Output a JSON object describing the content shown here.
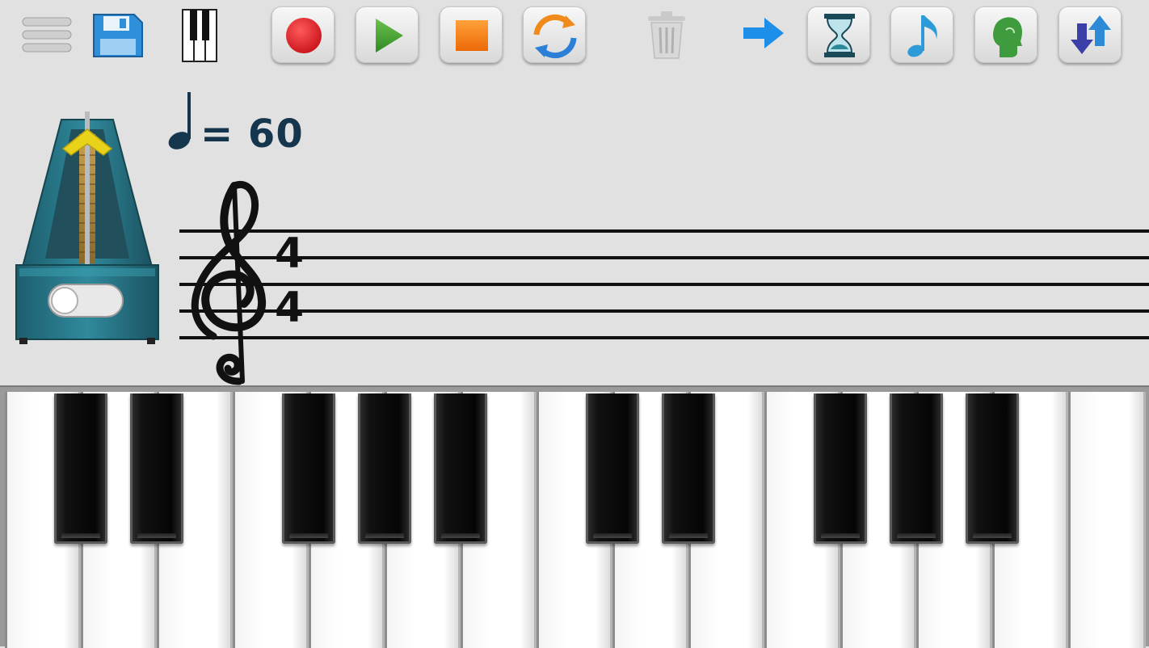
{
  "toolbar": {
    "buttons": [
      {
        "id": "menu",
        "icon": "menu-icon"
      },
      {
        "id": "save",
        "icon": "floppy-disk-icon"
      },
      {
        "id": "keyboard",
        "icon": "piano-keys-icon"
      },
      {
        "id": "record",
        "icon": "record-icon",
        "color": "#e01e25"
      },
      {
        "id": "play",
        "icon": "play-icon",
        "color": "#3a9a2a"
      },
      {
        "id": "stop",
        "icon": "stop-icon",
        "color": "#f07d10"
      },
      {
        "id": "loop",
        "icon": "loop-icon",
        "color": "#2b7fd6"
      },
      {
        "id": "delete",
        "icon": "trash-icon"
      },
      {
        "id": "next",
        "icon": "arrow-right-icon",
        "color": "#1e8fe8"
      },
      {
        "id": "tempo",
        "icon": "hourglass-icon"
      },
      {
        "id": "note",
        "icon": "music-note-icon"
      },
      {
        "id": "voice",
        "icon": "listen-head-icon"
      },
      {
        "id": "transpose",
        "icon": "up-down-arrows-icon"
      }
    ]
  },
  "tempo": {
    "note_icon": "quarter-note-icon",
    "text": "= 60"
  },
  "staff": {
    "clef": "treble-clef-icon",
    "time_signature": {
      "numerator": "4",
      "denominator": "4"
    }
  },
  "metronome": {
    "icon": "metronome-icon"
  },
  "keyboard": {
    "white_keys": [
      "C",
      "D",
      "E",
      "F",
      "G",
      "A",
      "B",
      "C",
      "D",
      "E",
      "F",
      "G",
      "A",
      "B",
      "C"
    ],
    "black_keys": [
      "C#",
      "D#",
      "F#",
      "G#",
      "A#",
      "C#",
      "D#",
      "F#",
      "G#",
      "A#"
    ]
  }
}
